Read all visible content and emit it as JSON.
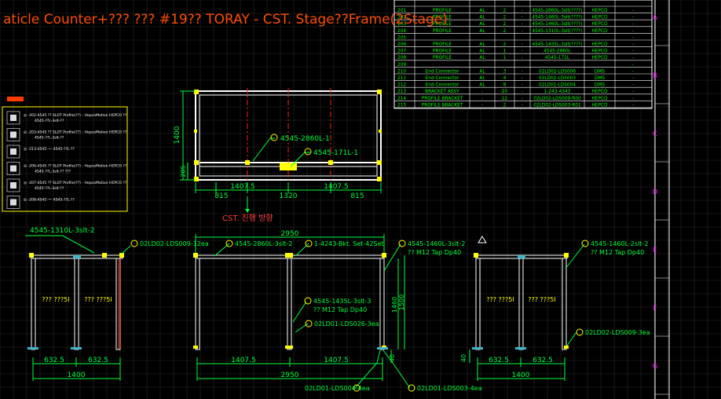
{
  "title": "aticle Counter+??? ??? #19?? TORAY - CST. Stage??Frame(2Stage)",
  "bom_rows": [
    {
      "no": "201",
      "name": "PROFILE",
      "mat": "AL",
      "qty": "2",
      "dash": "-",
      "spec": "4545-2860L-3slt(????)",
      "maker": "HEPCO"
    },
    {
      "no": "202",
      "name": "PROFILE",
      "mat": "AL",
      "qty": "2",
      "dash": "-",
      "spec": "4545-1460L-3slt(????)",
      "maker": "HEPCO"
    },
    {
      "no": "203",
      "name": "PROFILE",
      "mat": "AL",
      "qty": "2",
      "dash": "-",
      "spec": "4545-1460L-3slt(????)",
      "maker": "HEPCO"
    },
    {
      "no": "204",
      "name": "PROFILE",
      "mat": "AL",
      "qty": "2",
      "dash": "-",
      "spec": "4545-1310L-3slt(????)",
      "maker": "HEPCO"
    },
    {
      "no": "205",
      "name": "",
      "mat": "",
      "qty": "",
      "dash": "",
      "spec": "",
      "maker": ""
    },
    {
      "no": "206",
      "name": "PROFILE",
      "mat": "AL",
      "qty": "2",
      "dash": "-",
      "spec": "4545-1435L-3slt(????)",
      "maker": "HEPCO"
    },
    {
      "no": "207",
      "name": "PROFILE",
      "mat": "AL",
      "qty": "1",
      "dash": "-",
      "spec": "4545-2860L",
      "maker": "HEPCO"
    },
    {
      "no": "208",
      "name": "PROFILE",
      "mat": "AL",
      "qty": "1",
      "dash": "-",
      "spec": "4545-171L",
      "maker": "HEPCO"
    },
    {
      "no": "209",
      "name": "",
      "mat": "",
      "qty": "",
      "dash": "",
      "spec": "",
      "maker": ""
    },
    {
      "no": "210",
      "name": "End Connector",
      "mat": "AL",
      "qty": "3",
      "dash": "-",
      "spec": "02LD02-LDS006",
      "maker": "DMS"
    },
    {
      "no": "211",
      "name": "End Connector",
      "mat": "AL",
      "qty": "4",
      "dash": "-",
      "spec": "02LD02-LDS003",
      "maker": "DMS"
    },
    {
      "no": "212",
      "name": "End Connector",
      "mat": "AL",
      "qty": "8",
      "dash": "-",
      "spec": "02LD01-LDS004",
      "maker": "DMS"
    },
    {
      "no": "213",
      "name": "BRACKET ASSY",
      "mat": "-",
      "qty": "20",
      "dash": "-",
      "spec": "1-243-4343",
      "maker": "HEPCO"
    },
    {
      "no": "214",
      "name": "PROFILE BRACKET",
      "mat": "-",
      "qty": "12",
      "dash": "-",
      "spec": "02LD02-LDS009-R00",
      "maker": "HEPCO"
    },
    {
      "no": "215",
      "name": "PROFILE BRACKET",
      "mat": "-",
      "qty": "2",
      "dash": "-",
      "spec": "02LD02-LDS003-R01",
      "maker": "HEPCO"
    }
  ],
  "zone_letters": [
    "A",
    "B",
    "C",
    "D",
    "E",
    "F",
    "G"
  ],
  "legend_rows": [
    "◎ -202-4545 ?? SLOT Profile(??) : HepcoMotion HEPCO ?? : 4545-??L-3slt-??",
    "◎ -203-4545 ?? SLOT Profile(??) : HepcoMotion HEPCO ?? : 4545-??L-3slt-??",
    "◎ -213-4545 ── 4545-??L-??",
    "◎ -206-4545 ?? SLOT Profile(??) : HepcoMotion HEPCO ?? : 4545-??L-3slt-?? ???",
    "◎ -207-4545 ?? SLOT Profile(??) : HepcoMotion HEPCO ?? : 4545-??L-3slt-??",
    "◎ -208-4545 ── 4545-??L-??"
  ],
  "top_view": {
    "dim_height": "1400",
    "dim_small": "285",
    "dims_bottom": [
      "815",
      "1407.5",
      "1320",
      "1407.5",
      "815"
    ],
    "callout_a": "4545-2860L-1",
    "callout_b": "4545-171L-1",
    "direction_label": "CST. 진행 방향"
  },
  "left_view": {
    "callout_top": "4545-1310L-3slt-2",
    "callout_bracket": "02LD02-LDS009-12ea",
    "cell_labels": [
      "??? ???5I",
      "??? ???5I"
    ],
    "dims": [
      "632.5",
      "632.5"
    ],
    "dim_total": "1400"
  },
  "front_view": {
    "dim_top": "2950",
    "callout_profile": "4545-2860L-3slt-2",
    "callout_bracket": "1-4243-Bkt. Set-42Set",
    "callout_post": "4545-1460L-3slt-2",
    "callout_post_note": "?? M12 Tap Dp40",
    "callout_mid": "4545-1435L-3slt-3",
    "callout_mid_note": "?? M12 Tap Dp40",
    "callout_conn": "02LD01-LDS026-3ea",
    "dims": [
      "1407.5",
      "1407.5"
    ],
    "dim_total": "2950",
    "dim_height_a": "1460",
    "dim_height_b": "1500",
    "dim_foot": "40",
    "callout_bottom_a": "02LD01-LDS004-4ea",
    "callout_bottom_b": "02LD01-LDS003-4ea"
  },
  "right_view": {
    "callout_top": "4545-1460L-2slt-2",
    "callout_note": "?? M12 Tap Dp40",
    "callout_bottom": "02LD02-LDS009-3ea",
    "cell_labels": [
      "??? ???5I",
      "??? ???5I"
    ],
    "dims": [
      "632.5",
      "632.5"
    ],
    "dim_total": "1400",
    "dim_foot": "40"
  },
  "colors": {
    "background": "#000000",
    "title": "#ff4d00",
    "drawing": "#ffffff",
    "dimension": "#00ff3c",
    "callout": "#ffff00",
    "center_line": "#ff2020",
    "table_text": "#00ff00",
    "zone_text": "#ff00ff",
    "grid": "#2a2a2a"
  }
}
